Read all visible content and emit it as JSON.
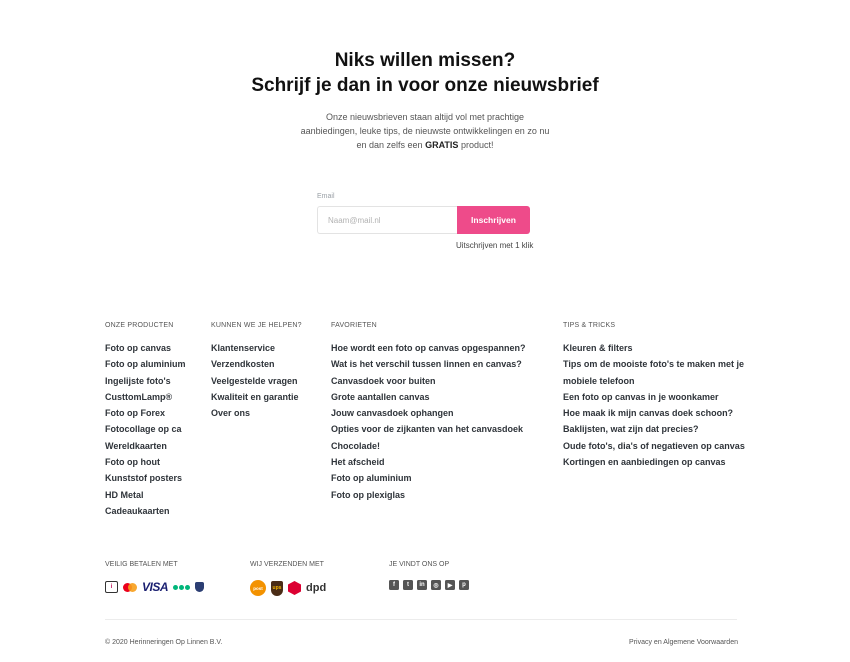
{
  "newsletter": {
    "title_line1": "Niks willen missen?",
    "title_line2": "Schrijf je dan in voor onze nieuwsbrief",
    "description_pre": "Onze nieuwsbrieven staan altijd vol met prachtige aanbiedingen, leuke tips, de nieuwste ontwikkelingen en zo nu en dan zelfs een",
    "description_bold": "GRATIS",
    "description_post": "product!",
    "email_label": "Email",
    "email_placeholder": "Naam@mail.nl",
    "subscribe_label": "Inschrijven",
    "unsubscribe_note": "Uitschrijven met 1 klik",
    "accent_color": "#ee4b8a"
  },
  "footer": {
    "columns": [
      {
        "title": "Onze producten",
        "items": [
          "Foto op canvas",
          "Foto op aluminium",
          "Ingelijste foto's",
          "CusttomLamp®",
          "Foto op Forex",
          "Fotocollage op ca",
          "Wereldkaarten",
          "Foto op hout",
          "Kunststof posters",
          "HD Metal",
          "Cadeaukaarten"
        ]
      },
      {
        "title": "Kunnen we je helpen?",
        "items": [
          "Klantenservice",
          "Verzendkosten",
          "Veelgestelde vragen",
          "Kwaliteit en garantie",
          "Over ons"
        ]
      },
      {
        "title": "Favorieten",
        "items": [
          "Hoe wordt een foto op canvas opgespannen?",
          "Wat is het verschil tussen linnen en canvas?",
          "Canvasdoek voor buiten",
          "Grote aantallen canvas",
          "Jouw canvasdoek ophangen",
          "Opties voor de zijkanten van het canvasdoek",
          "Chocolade!",
          "Het afscheid",
          "Foto op aluminium",
          "Foto op plexiglas"
        ]
      },
      {
        "title": "Tips & tricks",
        "items": [
          "Kleuren & filters",
          "Tips om de mooiste foto's te maken met je",
          "mobiele telefoon",
          "Een foto op canvas in je woonkamer",
          "Hoe maak ik mijn canvas doek schoon?",
          "Baklijsten, wat zijn dat precies?",
          "Oude foto's, dia's of negatieven op canvas",
          "Kortingen en aanbiedingen op canvas"
        ]
      }
    ],
    "payment_title": "Veilig betalen met",
    "payment_icons": [
      "ideal-icon",
      "mastercard-icon",
      "visa-icon",
      "thuiswinkel-icon",
      "safety-shield-icon"
    ],
    "visa_text": "VISA",
    "shipping_title": "Wij verzenden met",
    "shipping_icons": [
      "postnl-icon",
      "ups-icon",
      "dpd-icon"
    ],
    "dpd_text": "dpd",
    "social_title": "Je vindt ons op",
    "social_icons": [
      "facebook-icon",
      "twitter-icon",
      "linkedin-icon",
      "instagram-icon",
      "youtube-icon",
      "pinterest-icon"
    ],
    "copyright": "© 2020 Herinneringen Op Linnen B.V.",
    "privacy_link": "Privacy en Algemene Voorwaarden"
  }
}
